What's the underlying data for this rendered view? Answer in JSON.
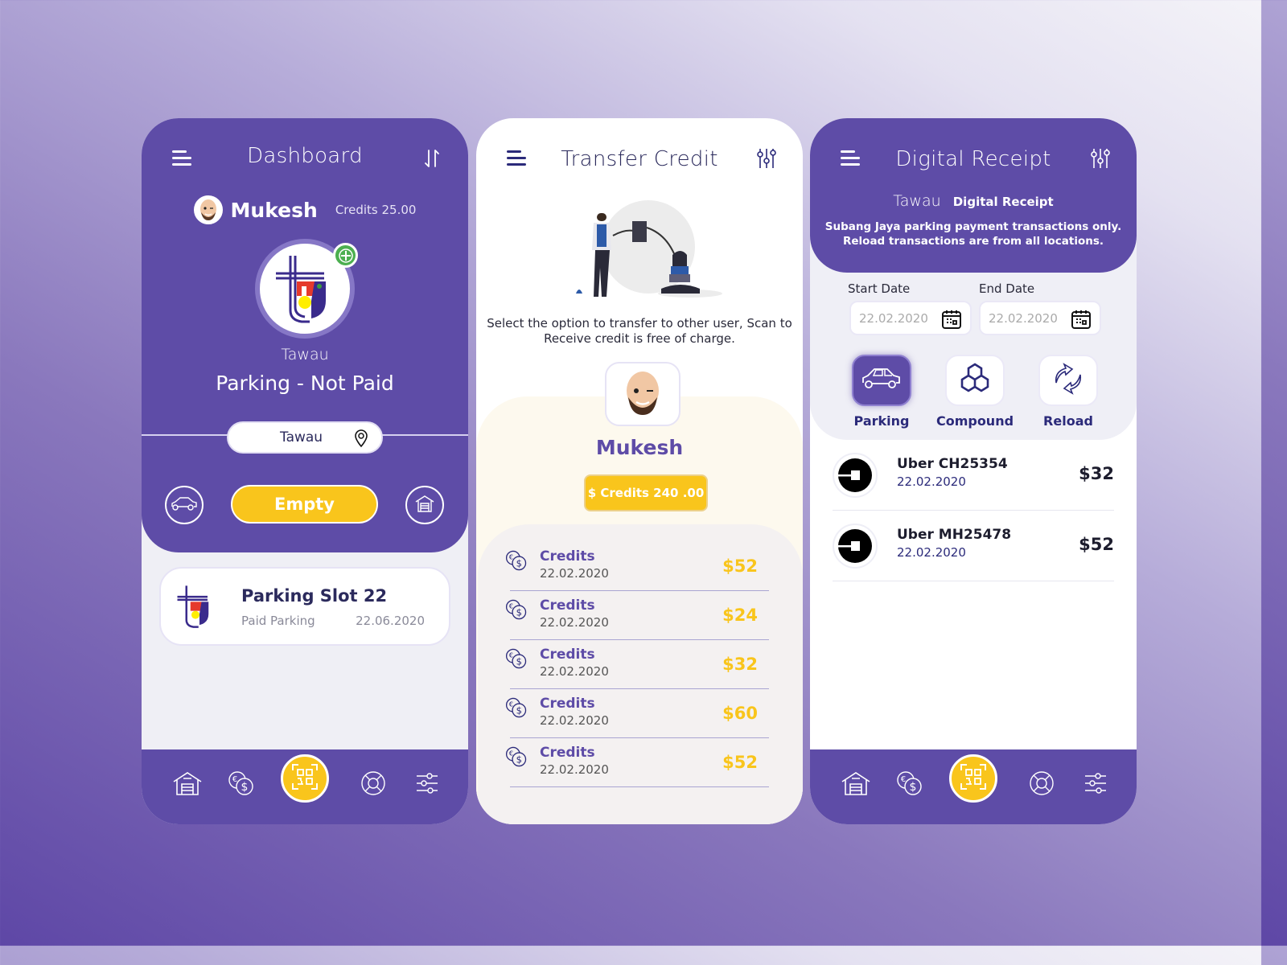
{
  "colors": {
    "primary": "#5e4ca7",
    "accent_yellow": "#f9c51c",
    "add_green": "#4caf50",
    "navy": "#2b2a7a"
  },
  "dashboard": {
    "title": "Dashboard",
    "menu_icon": "hamburger-menu-icon",
    "sort_icon": "sort-arrows-icon",
    "user": {
      "name": "Mukesh",
      "credits": "Credits 25.00",
      "avatar": "memoji-avatar"
    },
    "logo": "tawau-municipal-logo",
    "add_icon": "plus-circle-icon",
    "city": "Tawau",
    "status": "Parking - Not Paid",
    "location": {
      "label": "Tawau",
      "icon": "map-pin-icon"
    },
    "actions": {
      "left_icon": "car-icon",
      "main_label": "Empty",
      "right_icon": "garage-icon"
    },
    "slot_card": {
      "title": "Parking Slot 22",
      "subtitle": "Paid Parking",
      "date": "22.06.2020"
    }
  },
  "transfer": {
    "title": "Transfer Credit",
    "menu_icon": "hamburger-menu-icon",
    "filter_icon": "sliders-icon",
    "illustration": "money-transfer-illustration",
    "description": "Select the option to transfer to other user, Scan to Receive credit is free of charge.",
    "user": {
      "name": "Mukesh",
      "avatar": "memoji-avatar"
    },
    "credits_badge": "$ Credits 240 .00",
    "items": [
      {
        "label": "Credits",
        "date": "22.02.2020",
        "amount": "$52"
      },
      {
        "label": "Credits",
        "date": "22.02.2020",
        "amount": "$24"
      },
      {
        "label": "Credits",
        "date": "22.02.2020",
        "amount": "$32"
      },
      {
        "label": "Credits",
        "date": "22.02.2020",
        "amount": "$60"
      },
      {
        "label": "Credits",
        "date": "22.02.2020",
        "amount": "$52"
      }
    ]
  },
  "receipt": {
    "title": "Digital Receipt",
    "menu_icon": "hamburger-menu-icon",
    "filter_icon": "sliders-icon",
    "city": "Tawau",
    "subtitle": "Digital Receipt",
    "note_line1": "Subang Jaya parking payment transactions only.",
    "note_line2": "Reload transactions are from all locations.",
    "start_label": "Start Date",
    "start_value": "22.02.2020",
    "end_label": "End Date",
    "end_value": "22.02.2020",
    "categories": [
      {
        "label": "Parking",
        "icon": "car-icon",
        "active": true
      },
      {
        "label": "Compound",
        "icon": "hexagon-network-icon",
        "active": false
      },
      {
        "label": "Reload",
        "icon": "reload-arrows-icon",
        "active": false
      }
    ],
    "transactions": [
      {
        "title": "Uber CH25354",
        "date": "22.02.2020",
        "amount": "$32",
        "logo": "uber-logo"
      },
      {
        "title": "Uber MH25478",
        "date": "22.02.2020",
        "amount": "$52",
        "logo": "uber-logo"
      }
    ]
  },
  "bottom_nav": [
    {
      "name": "home",
      "icon": "garage-home-icon"
    },
    {
      "name": "currency",
      "icon": "currency-exchange-icon"
    },
    {
      "name": "scan",
      "icon": "qr-scan-icon"
    },
    {
      "name": "support",
      "icon": "lifebuoy-icon"
    },
    {
      "name": "settings",
      "icon": "sliders-icon"
    }
  ]
}
